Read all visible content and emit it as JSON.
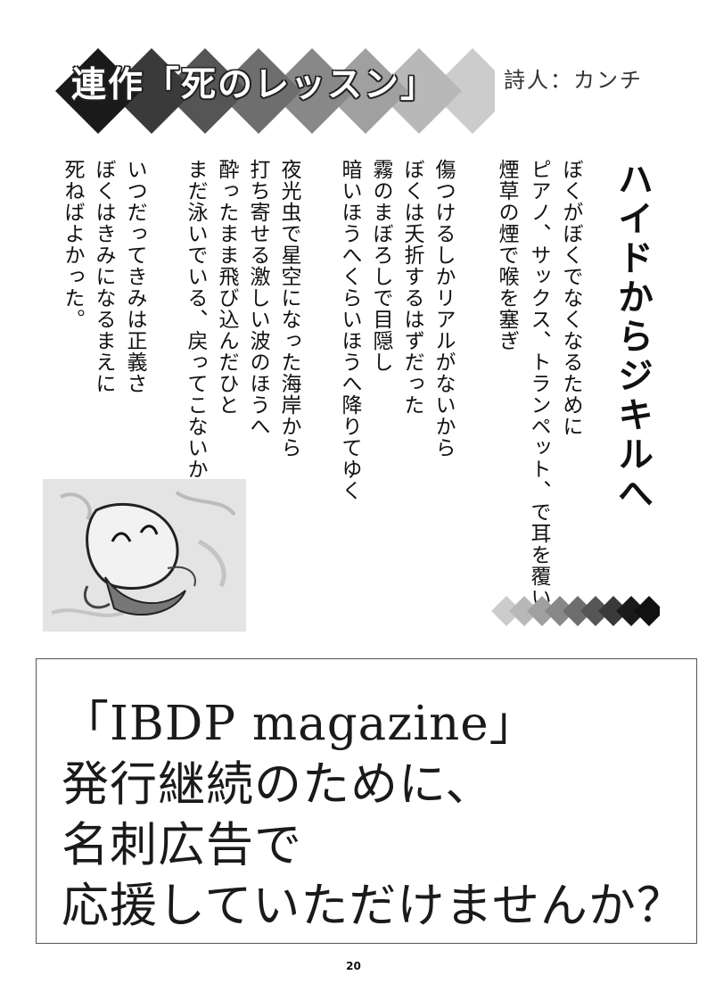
{
  "header": {
    "series_title": "連作「死のレッスン」",
    "author": "詩人：カンチ",
    "colors": [
      "#1a1a1a",
      "#3a3a3a",
      "#555555",
      "#6e6e6e",
      "#888888",
      "#a0a0a0",
      "#b8b8b8",
      "#cccccc"
    ]
  },
  "poem": {
    "title": "ハイドからジキルへ",
    "lines": [
      "ぼくがぼくでなくなるために",
      "ピアノ、サックス、トランペット、で耳を覆い",
      "煙草の煙で喉を塞ぎ",
      "",
      "傷つけるしかリアルがないから",
      "ぼくは夭折するはずだった",
      "霧のまぼろしで目隠し",
      "暗いほうへくらいほうへ降りてゆく",
      "",
      "夜光虫で星空になった海岸から",
      "打ち寄せる激しい波のほうへ",
      "酔ったまま飛び込んだひと",
      "まだ泳いでいる、戻ってこないから",
      "",
      "いつだってきみは正義さ",
      "ぼくはきみになるまえに",
      "死ねばよかった。"
    ]
  },
  "illustration": {
    "icon": "crying-face-drawing-icon"
  },
  "ad": {
    "lines": [
      "「IBDP magazine」",
      "発行継続のために、",
      "名刺広告で",
      "応援していただけませんか？"
    ]
  },
  "page_number": "20"
}
